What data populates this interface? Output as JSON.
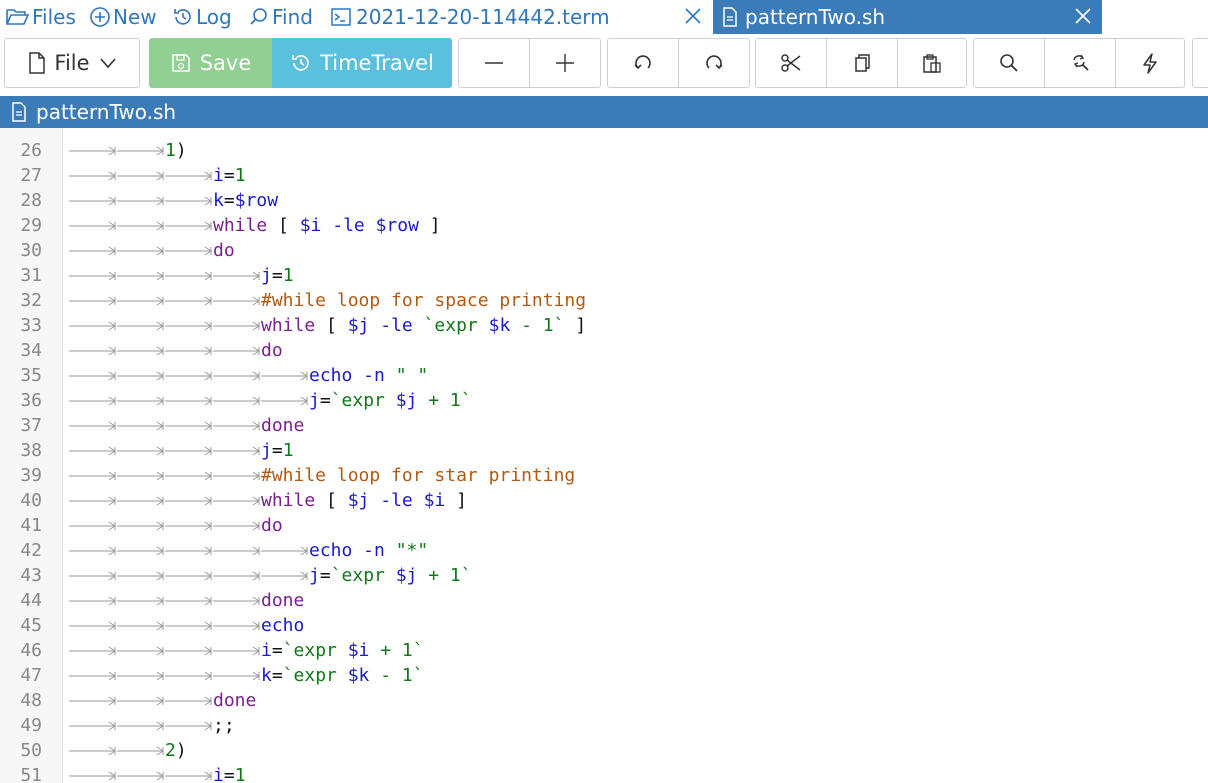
{
  "nav": {
    "files": "Files",
    "new": "New",
    "log": "Log",
    "find": "Find"
  },
  "tabs": [
    {
      "label": "2021-12-20-114442.term",
      "active": false
    },
    {
      "label": "patternTwo.sh",
      "active": true
    }
  ],
  "toolbar": {
    "file_label": "File",
    "save_label": "Save",
    "timetravel_label": "TimeTravel"
  },
  "file_header": "patternTwo.sh",
  "colors": {
    "accent": "#3a7bb8",
    "save": "#92cf93",
    "timetravel": "#5bc0de",
    "keyword": "#7a1f8f",
    "variable": "#1a1ac9",
    "number": "#11781a",
    "comment": "#b05a12"
  },
  "code_lines": [
    {
      "n": "26",
      "indent": 2,
      "tokens": [
        [
          "num",
          "1"
        ],
        [
          "op",
          ")"
        ]
      ]
    },
    {
      "n": "27",
      "indent": 3,
      "tokens": [
        [
          "var",
          "i"
        ],
        [
          "op",
          "="
        ],
        [
          "num",
          "1"
        ]
      ]
    },
    {
      "n": "28",
      "indent": 3,
      "tokens": [
        [
          "var",
          "k"
        ],
        [
          "op",
          "="
        ],
        [
          "var",
          "$row"
        ]
      ]
    },
    {
      "n": "29",
      "indent": 3,
      "tokens": [
        [
          "kw",
          "while"
        ],
        [
          "op",
          " [ "
        ],
        [
          "var",
          "$i"
        ],
        [
          "var",
          " -le "
        ],
        [
          "var",
          "$row"
        ],
        [
          "op",
          " ]"
        ]
      ]
    },
    {
      "n": "30",
      "indent": 3,
      "tokens": [
        [
          "kw",
          "do"
        ]
      ]
    },
    {
      "n": "31",
      "indent": 4,
      "tokens": [
        [
          "var",
          "j"
        ],
        [
          "op",
          "="
        ],
        [
          "num",
          "1"
        ]
      ]
    },
    {
      "n": "32",
      "indent": 4,
      "tokens": [
        [
          "cmt",
          "#while loop for space printing"
        ]
      ]
    },
    {
      "n": "33",
      "indent": 4,
      "tokens": [
        [
          "kw",
          "while"
        ],
        [
          "op",
          " [ "
        ],
        [
          "var",
          "$j"
        ],
        [
          "var",
          " -le "
        ],
        [
          "str",
          "`expr "
        ],
        [
          "var",
          "$k"
        ],
        [
          "str",
          " - 1`"
        ],
        [
          "op",
          " ]"
        ]
      ]
    },
    {
      "n": "34",
      "indent": 4,
      "tokens": [
        [
          "kw",
          "do"
        ]
      ]
    },
    {
      "n": "35",
      "indent": 5,
      "tokens": [
        [
          "var",
          "echo -n "
        ],
        [
          "str",
          "\" \""
        ]
      ]
    },
    {
      "n": "36",
      "indent": 5,
      "tokens": [
        [
          "var",
          "j"
        ],
        [
          "op",
          "="
        ],
        [
          "str",
          "`expr "
        ],
        [
          "var",
          "$j"
        ],
        [
          "str",
          " + 1`"
        ]
      ]
    },
    {
      "n": "37",
      "indent": 4,
      "tokens": [
        [
          "kw",
          "done"
        ]
      ]
    },
    {
      "n": "38",
      "indent": 4,
      "tokens": [
        [
          "var",
          "j"
        ],
        [
          "op",
          "="
        ],
        [
          "num",
          "1"
        ]
      ]
    },
    {
      "n": "39",
      "indent": 4,
      "tokens": [
        [
          "cmt",
          "#while loop for star printing"
        ]
      ]
    },
    {
      "n": "40",
      "indent": 4,
      "tokens": [
        [
          "kw",
          "while"
        ],
        [
          "op",
          " [ "
        ],
        [
          "var",
          "$j"
        ],
        [
          "var",
          " -le "
        ],
        [
          "var",
          "$i"
        ],
        [
          "op",
          " ]"
        ]
      ]
    },
    {
      "n": "41",
      "indent": 4,
      "tokens": [
        [
          "kw",
          "do"
        ]
      ]
    },
    {
      "n": "42",
      "indent": 5,
      "tokens": [
        [
          "var",
          "echo -n "
        ],
        [
          "str",
          "\"*\""
        ]
      ]
    },
    {
      "n": "43",
      "indent": 5,
      "tokens": [
        [
          "var",
          "j"
        ],
        [
          "op",
          "="
        ],
        [
          "str",
          "`expr "
        ],
        [
          "var",
          "$j"
        ],
        [
          "str",
          " + 1`"
        ]
      ]
    },
    {
      "n": "44",
      "indent": 4,
      "tokens": [
        [
          "kw",
          "done"
        ]
      ]
    },
    {
      "n": "45",
      "indent": 4,
      "tokens": [
        [
          "var",
          "echo"
        ]
      ]
    },
    {
      "n": "46",
      "indent": 4,
      "tokens": [
        [
          "var",
          "i"
        ],
        [
          "op",
          "="
        ],
        [
          "str",
          "`expr "
        ],
        [
          "var",
          "$i"
        ],
        [
          "str",
          " + 1`"
        ]
      ]
    },
    {
      "n": "47",
      "indent": 4,
      "tokens": [
        [
          "var",
          "k"
        ],
        [
          "op",
          "="
        ],
        [
          "str",
          "`expr "
        ],
        [
          "var",
          "$k"
        ],
        [
          "str",
          " - 1`"
        ]
      ]
    },
    {
      "n": "48",
      "indent": 3,
      "tokens": [
        [
          "kw",
          "done"
        ]
      ]
    },
    {
      "n": "49",
      "indent": 3,
      "tokens": [
        [
          "op",
          ";;"
        ]
      ]
    },
    {
      "n": "50",
      "indent": 2,
      "tokens": [
        [
          "num",
          "2"
        ],
        [
          "op",
          ")"
        ]
      ]
    },
    {
      "n": "51",
      "indent": 3,
      "tokens": [
        [
          "var",
          "i"
        ],
        [
          "op",
          "="
        ],
        [
          "num",
          "1"
        ]
      ]
    }
  ]
}
